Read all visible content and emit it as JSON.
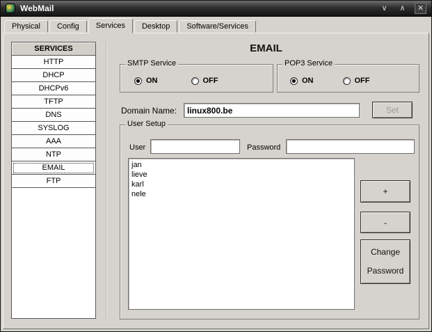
{
  "window": {
    "title": "WebMail",
    "controls": {
      "shade": "∨",
      "maximize": "∧",
      "close": "✕"
    }
  },
  "tabs": [
    {
      "label": "Physical"
    },
    {
      "label": "Config"
    },
    {
      "label": "Services"
    },
    {
      "label": "Desktop"
    },
    {
      "label": "Software/Services"
    }
  ],
  "active_tab": "Services",
  "sidebar": {
    "header": "SERVICES",
    "items": [
      {
        "label": "HTTP"
      },
      {
        "label": "DHCP"
      },
      {
        "label": "DHCPv6"
      },
      {
        "label": "TFTP"
      },
      {
        "label": "DNS"
      },
      {
        "label": "SYSLOG"
      },
      {
        "label": "AAA"
      },
      {
        "label": "NTP"
      },
      {
        "label": "EMAIL"
      },
      {
        "label": "FTP"
      }
    ],
    "selected": "EMAIL"
  },
  "main": {
    "title": "EMAIL",
    "smtp": {
      "legend": "SMTP Service",
      "on": "ON",
      "off": "OFF",
      "selected": "ON"
    },
    "pop3": {
      "legend": "POP3 Service",
      "on": "ON",
      "off": "OFF",
      "selected": "ON"
    },
    "domain": {
      "label": "Domain Name:",
      "value": "linux800.be",
      "set": "Set",
      "set_enabled": false
    },
    "user_setup": {
      "legend": "User Setup",
      "user_label": "User",
      "user_value": "",
      "password_label": "Password",
      "password_value": "",
      "users": [
        "jan",
        "lieve",
        "karl",
        "nele"
      ],
      "add": "+",
      "remove": "-",
      "change_password": "Change Password"
    }
  }
}
